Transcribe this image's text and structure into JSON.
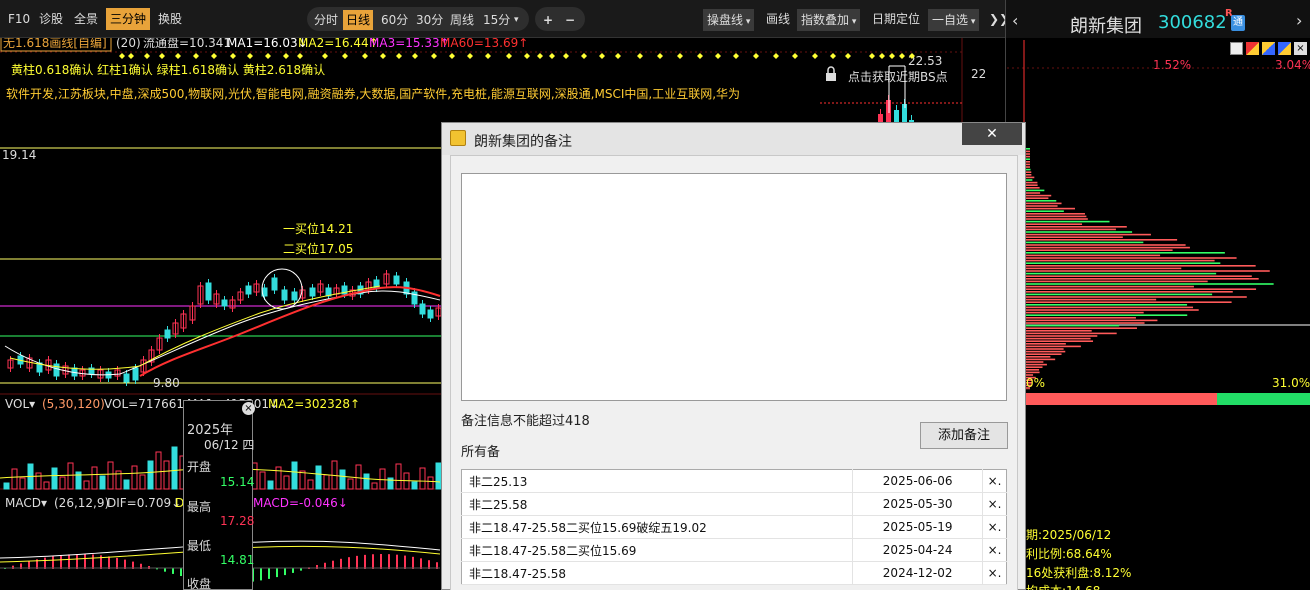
{
  "toolbar": {
    "left_buttons": [
      "F10",
      "诊股",
      "全景",
      "三分钟",
      "换股"
    ],
    "periods": [
      "分时",
      "日线",
      "60分",
      "30分",
      "周线",
      "15分"
    ],
    "period_active": "日线",
    "zoom_in": "+",
    "zoom_out": "−",
    "tools": {
      "draw_line_dropdown": "操盘线",
      "draw": "画线",
      "index_overlay": "指数叠加",
      "date_locate": "日期定位",
      "watchlist": "一自选"
    },
    "collapse": "❯❯"
  },
  "chart": {
    "indicator_selector": "无1.618画线[自编]",
    "ma_params": "(20)",
    "float_shares": "流通盘=10.341",
    "ma1": "MA1=16.03↓",
    "ma2": "MA2=16.44↑",
    "ma3": "MA3=15.33↑",
    "ma60": "MA60=13.69↑",
    "confirm_line": "黄柱0.618确认 红柱1确认 绿柱1.618确认 黄柱2.618确认",
    "concepts": "软件开发,江苏板块,中盘,深成500,物联网,光伏,智能电网,融资融券,大数据,国产软件,充电桩,能源互联网,深股通,MSCI中国,工业互联网,华为",
    "bs_hint": "点击获取近期BS点",
    "price_19_14": "19.14",
    "label_buy1": "一买位14.21",
    "label_buy2": "二买位17.05",
    "low_price": "9.80",
    "high_price": "22.53",
    "axis_22": "22",
    "vol_selector": "VOL▾",
    "vol_params": "(5,30,120)",
    "vol": "VOL=717661↑",
    "vol_ma1": "MA1=415301↓",
    "vol_ma2": "MA2=302328↑",
    "macd_selector": "MACD▾",
    "macd_params": "(26,12,9)",
    "dif": "DIF=0.709↓",
    "dea_partial": "D",
    "macd_val": "MACD=-0.046↓"
  },
  "tooltip": {
    "year": "2025年",
    "date": "06/12 四",
    "open_label": "开盘",
    "open_val": "15.14",
    "high_label": "最高",
    "high_val": "17.28",
    "low_label": "最低",
    "low_val": "14.81",
    "close_label": "收盘"
  },
  "right_panel": {
    "stock_name": "朗新集团",
    "code": "300682",
    "tag_r": "R",
    "tag_tong": "通",
    "pct_left": "1.52%",
    "pct_right": "3.04%",
    "zero_pct": "0%",
    "pct_31": "31.0%",
    "date_line": "期:2025/06/12",
    "profit_ratio": "利比例:68.64%",
    "profit_line": "16处获利盘:8.12%",
    "cost_partial": "均成本:14.68"
  },
  "dialog": {
    "title": "朗新集团的备注",
    "close": "✕",
    "limit_text": "备注信息不能超过418",
    "all_label": "所有备",
    "add_button": "添加备注",
    "notes": [
      {
        "text": "非二25.13",
        "date": "2025-06-06",
        "del": "×."
      },
      {
        "text": "非二25.58",
        "date": "2025-05-30",
        "del": "×."
      },
      {
        "text": "非二18.47-25.58二买位15.69破绽五19.02",
        "date": "2025-05-19",
        "del": "×."
      },
      {
        "text": "非二18.47-25.58二买位15.69",
        "date": "2025-04-24",
        "del": "×."
      },
      {
        "text": "非二18.47-25.58",
        "date": "2024-12-02",
        "del": "×."
      }
    ]
  },
  "colors": {
    "accent": "#e8a33a",
    "up": "#ff3355",
    "down": "#33dddd",
    "ma_white": "#ffffff",
    "ma_yellow": "#ffff33",
    "ma_magenta": "#ff33ff",
    "ma_red": "#ff3030",
    "green": "#33ff66"
  }
}
